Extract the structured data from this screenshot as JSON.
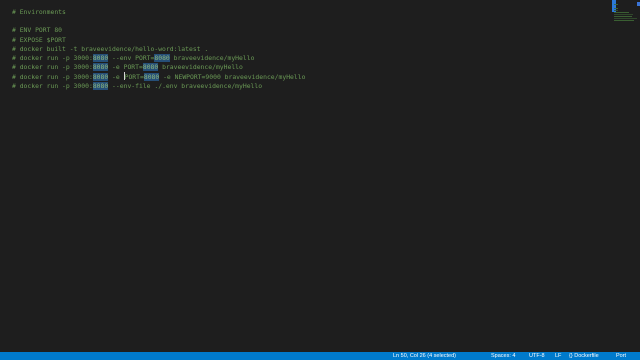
{
  "editor": {
    "lines": [
      {
        "segments": [
          {
            "text": "# Environments",
            "hl": false
          }
        ]
      },
      {
        "segments": [
          {
            "text": "",
            "hl": false
          }
        ]
      },
      {
        "segments": [
          {
            "text": "# ENV PORT 80",
            "hl": false
          }
        ]
      },
      {
        "segments": [
          {
            "text": "# EXPOSE $PORT",
            "hl": false
          }
        ]
      },
      {
        "segments": [
          {
            "text": "# docker built -t braveevidence/hello-word:latest .",
            "hl": false
          }
        ]
      },
      {
        "segments": [
          {
            "text": "# docker run -p 3000:",
            "hl": false
          },
          {
            "text": "8080",
            "hl": true
          },
          {
            "text": " --env PORT=",
            "hl": false
          },
          {
            "text": "8080",
            "hl": true
          },
          {
            "text": " braveevidence/myHello",
            "hl": false
          }
        ]
      },
      {
        "segments": [
          {
            "text": "# docker run -p 3000:",
            "hl": false
          },
          {
            "text": "8080",
            "hl": true
          },
          {
            "text": " -e PORT=",
            "hl": false
          },
          {
            "text": "8080",
            "hl": true
          },
          {
            "text": " braveevidence/myHello",
            "hl": false
          }
        ]
      },
      {
        "segments": [
          {
            "text": "# docker run -p 3000:",
            "hl": false
          },
          {
            "text": "8080",
            "hl": true
          },
          {
            "text": " -e ",
            "hl": false
          },
          {
            "text": "CURSOR",
            "hl": false
          },
          {
            "text": "PORT=",
            "hl": false
          },
          {
            "text": "8080",
            "hl": true
          },
          {
            "text": " -e NEWPORT=9000 braveevidence/myHello",
            "hl": false
          }
        ]
      },
      {
        "segments": [
          {
            "text": "# docker run -p 3000:",
            "hl": false
          },
          {
            "text": "8080",
            "hl": true
          },
          {
            "text": " --env-file ./.env braveevidence/myHello",
            "hl": false
          }
        ]
      }
    ]
  },
  "statusbar": {
    "position": "Ln 50, Col 26 (4 selected)",
    "spaces": "Spaces: 4",
    "encoding": "UTF-8",
    "eol": "LF",
    "language": "Dockerfile",
    "port": "Port"
  },
  "colors": {
    "background": "#1e1e1e",
    "comment": "#6a9955",
    "selection_highlight": "#264f78",
    "statusbar": "#007acc"
  }
}
